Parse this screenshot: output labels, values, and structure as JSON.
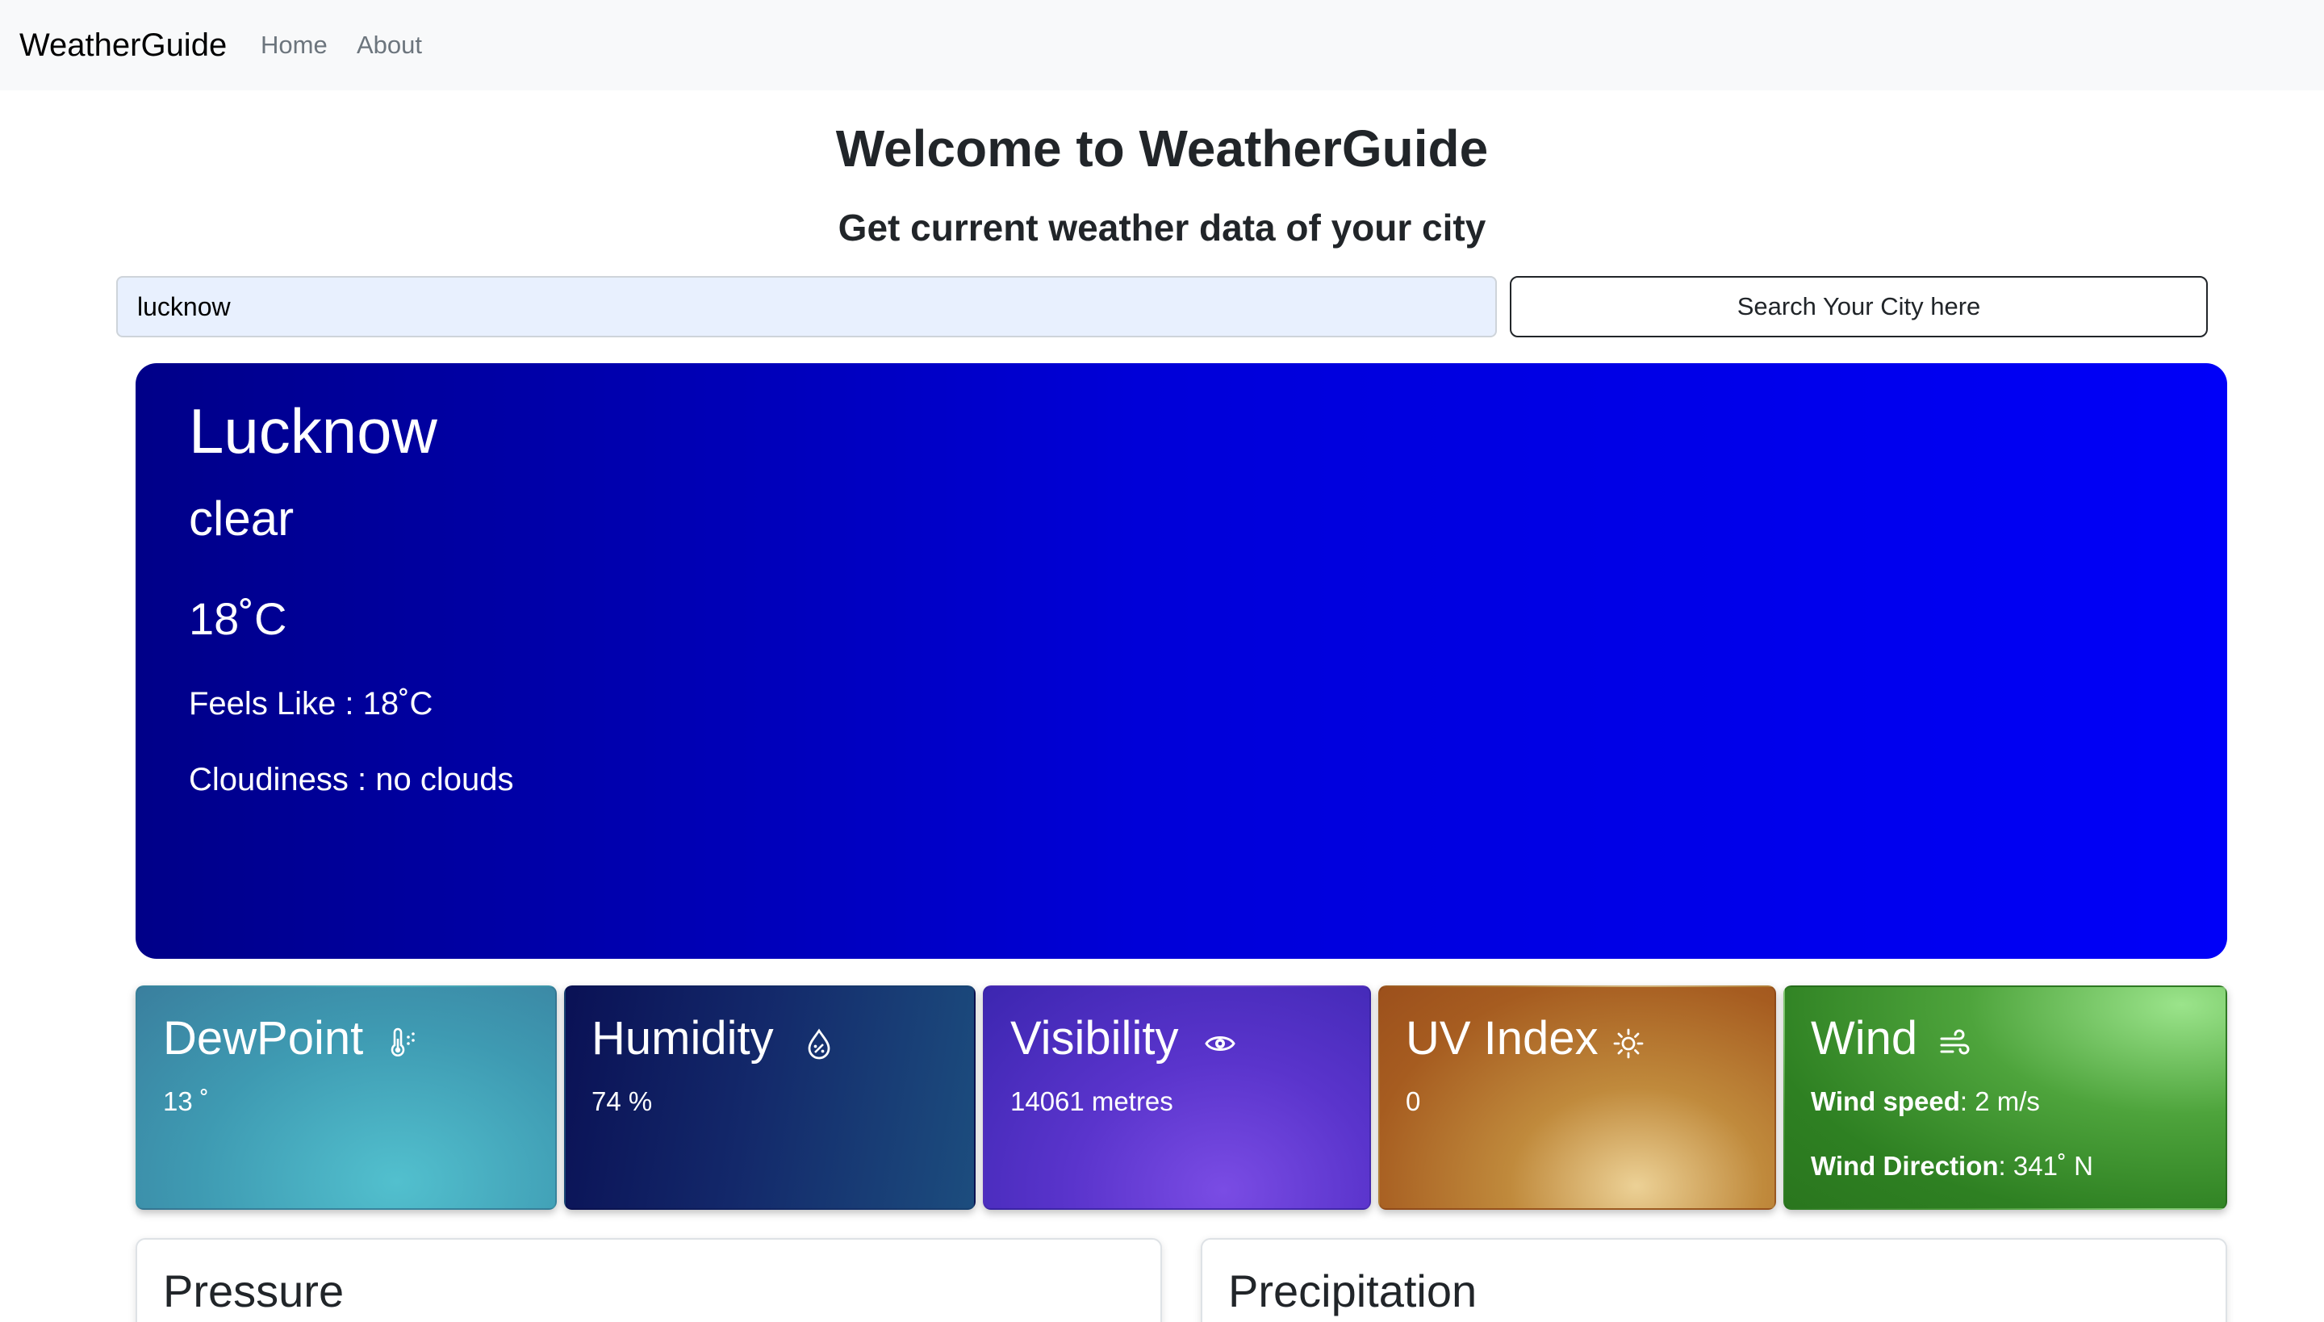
{
  "navbar": {
    "brand": "WeatherGuide",
    "links": [
      {
        "label": "Home"
      },
      {
        "label": "About"
      }
    ]
  },
  "header": {
    "title": "Welcome to WeatherGuide",
    "subtitle": "Get current weather data of your city"
  },
  "search": {
    "value": "lucknow",
    "button_label": "Search Your City here"
  },
  "current": {
    "city": "Lucknow",
    "description": "clear",
    "temperature": "18˚C",
    "feels_like": "Feels Like : 18˚C",
    "cloudiness": "Cloudiness : no clouds",
    "card_color": "#0000d8"
  },
  "stats": {
    "dewpoint": {
      "title": "DewPoint",
      "value": "13 ˚",
      "icon": "thermometer-snow-icon",
      "color": "#3e9ab2"
    },
    "humidity": {
      "title": "Humidity",
      "value": "74 %",
      "icon": "droplet-half-icon",
      "color": "#13286a"
    },
    "visibility": {
      "title": "Visibility",
      "value": "14061 metres",
      "icon": "eye-icon",
      "color": "#5a34cc"
    },
    "uv": {
      "title": "UV Index",
      "value": "0",
      "icon": "sun-icon",
      "color": "#a65c20"
    },
    "wind": {
      "title": "Wind",
      "icon": "wind-icon",
      "color": "#2e8022",
      "speed_label": "Wind speed",
      "speed_value": ": 2 m/s",
      "direction_label": "Wind Direction",
      "direction_value": ": 341˚ N"
    }
  },
  "panels": {
    "pressure": {
      "title": "Pressure"
    },
    "precipitation": {
      "title": "Precipitation"
    }
  }
}
